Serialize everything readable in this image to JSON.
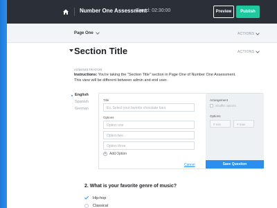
{
  "topbar": {
    "title": "Number One Assessment",
    "timed": "Timed: 02:30:00",
    "preview_label": "Preview",
    "publish_label": "Publish"
  },
  "page_row": {
    "page_label": "Page One",
    "actions_label": "ACTIONS"
  },
  "section": {
    "title": "Section Title",
    "actions_label": "ACTIONS",
    "role_label": "ADMINISTRATOR",
    "instructions_bold": "Instructions:",
    "instructions_text": " You're taking the \"Section Title\" section in Page One of Number One Assessment. This view will be different between admin and end user."
  },
  "languages": [
    "English",
    "Spanish",
    "German"
  ],
  "editor": {
    "title_label": "Title",
    "title_placeholder": "Ex. Select your favorite chocolate bars",
    "options_label": "Options",
    "options": [
      "Option one",
      "Option two",
      "Option three"
    ],
    "add_option_label": "Add Option",
    "cancel_label": "Cancel",
    "arrangement_label": "Arrangement",
    "shuffle_label": "Shuffle options",
    "options_count_label": "Options",
    "min_placeholder": "# min",
    "max_placeholder": "# max",
    "save_label": "Save Question"
  },
  "question2": {
    "title": "2. What is your favorite genre of music?",
    "answers": [
      {
        "label": "Hip-hop",
        "selected": true
      },
      {
        "label": "Classical",
        "selected": false
      }
    ]
  },
  "colors": {
    "accent": "#2b8ff0",
    "publish": "#1fc9a0",
    "topbar": "#2a2f38"
  }
}
